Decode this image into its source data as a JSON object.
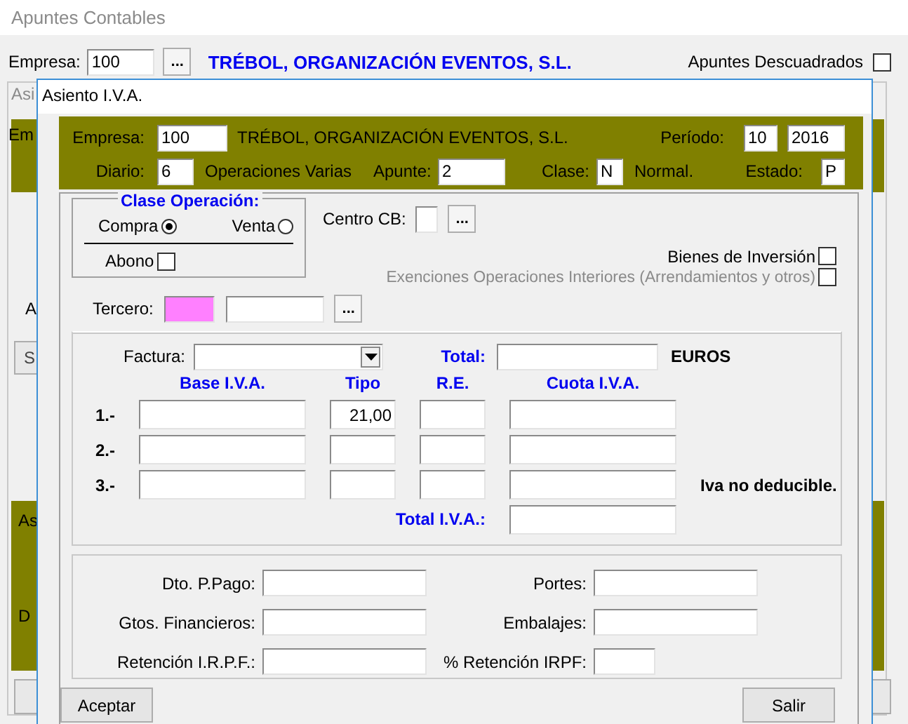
{
  "window": {
    "title": "Apuntes Contables"
  },
  "toolbar": {
    "empresa_label": "Empresa:",
    "empresa_value": "100",
    "browse": "...",
    "company_name": "TRÉBOL, ORGANIZACIÓN EVENTOS, S.L.",
    "descuadrados_label": "Apuntes Descuadrados",
    "descuadrados_checked": false
  },
  "background_fragments": [
    {
      "kind": "tab",
      "text": "Asi"
    },
    {
      "kind": "band",
      "text": "Em"
    },
    {
      "kind": "label",
      "text": "A"
    },
    {
      "kind": "button",
      "text": "S"
    },
    {
      "kind": "band",
      "text": "As"
    },
    {
      "kind": "band",
      "text": "D"
    }
  ],
  "dialog": {
    "title": "Asiento I.V.A.",
    "header": {
      "empresa_label": "Empresa:",
      "empresa_value": "100",
      "company_name": "TRÉBOL, ORGANIZACIÓN EVENTOS, S.L.",
      "periodo_label": "Período:",
      "periodo_month": "10",
      "periodo_year": "2016",
      "diario_label": "Diario:",
      "diario_value": "6",
      "diario_name": "Operaciones Varias",
      "apunte_label": "Apunte:",
      "apunte_value": "2",
      "clase_label": "Clase:",
      "clase_value": "N",
      "clase_name": "Normal.",
      "estado_label": "Estado:",
      "estado_value": "P"
    },
    "clase_operacion": {
      "title": "Clase Operación:",
      "options": [
        {
          "label": "Compra",
          "selected": true
        },
        {
          "label": "Venta",
          "selected": false
        }
      ],
      "abono": {
        "label": "Abono",
        "checked": false
      }
    },
    "centro_cb": {
      "label": "Centro CB:",
      "browse": "..."
    },
    "checks": [
      {
        "label": "Bienes de Inversión",
        "checked": false,
        "disabled": false
      },
      {
        "label": "Exenciones Operaciones Interiores (Arrendamientos y otros)",
        "checked": false,
        "disabled": true
      }
    ],
    "tercero": {
      "label": "Tercero:",
      "focused": true,
      "browse": "..."
    },
    "factura_label": "Factura:",
    "total_label": "Total:",
    "currency": "EUROS",
    "columns": [
      "Base I.V.A.",
      "Tipo",
      "R.E.",
      "Cuota I.V.A."
    ],
    "rows": [
      {
        "label": "1.-",
        "tipo": "21,00"
      },
      {
        "label": "2.-"
      },
      {
        "label": "3.-",
        "note": "Iva no deducible."
      }
    ],
    "total_iva_label": "Total I.V.A.:",
    "extras": [
      {
        "label": "Dto. P.Pago:",
        "kind": "wide"
      },
      {
        "label": "Portes:",
        "kind": "wide"
      },
      {
        "label": "Gtos. Financieros:",
        "kind": "wide"
      },
      {
        "label": "Embalajes:",
        "kind": "wide"
      },
      {
        "label": "Retención I.R.P.F.:",
        "kind": "wide"
      },
      {
        "label": "% Retención IRPF:",
        "kind": "narrow"
      }
    ],
    "buttons": [
      {
        "label": "Aceptar"
      },
      {
        "label": "Salir"
      }
    ]
  }
}
